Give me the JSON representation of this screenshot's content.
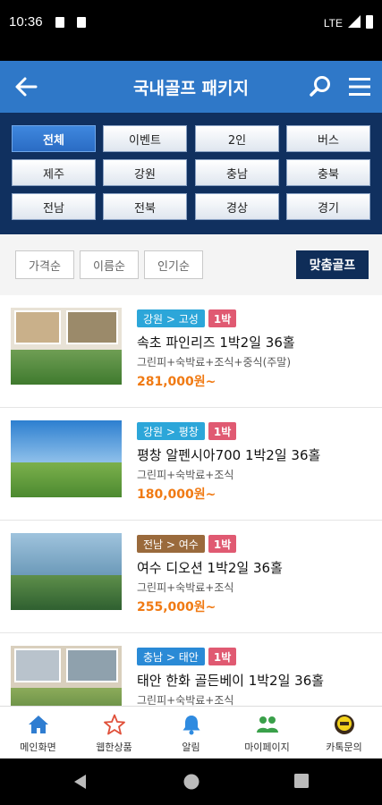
{
  "status_bar": {
    "time": "10:36",
    "network": "LTE"
  },
  "header": {
    "title": "국내골프 패키지",
    "back_icon": "back-arrow-icon",
    "search_icon": "search-icon",
    "menu_icon": "hamburger-menu-icon"
  },
  "filters": [
    {
      "label": "전체",
      "active": true
    },
    {
      "label": "이벤트",
      "active": false
    },
    {
      "label": "2인",
      "active": false
    },
    {
      "label": "버스",
      "active": false
    },
    {
      "label": "제주",
      "active": false
    },
    {
      "label": "강원",
      "active": false
    },
    {
      "label": "충남",
      "active": false
    },
    {
      "label": "충북",
      "active": false
    },
    {
      "label": "전남",
      "active": false
    },
    {
      "label": "전북",
      "active": false
    },
    {
      "label": "경상",
      "active": false
    },
    {
      "label": "경기",
      "active": false
    }
  ],
  "sort": {
    "options": [
      "가격순",
      "이름순",
      "인기순"
    ],
    "custom_label": "맞춤골프"
  },
  "products": [
    {
      "region": "강원 > 고성",
      "region_color": "#2ca6d9",
      "nights": "1박",
      "title": "속초 파인리즈 1박2일 36홀",
      "desc": "그린피+숙박료+조식+중식(주말)",
      "price": "281,000원~"
    },
    {
      "region": "강원 > 평창",
      "region_color": "#2ca6d9",
      "nights": "1박",
      "title": "평창 알펜시아700 1박2일 36홀",
      "desc": "그린피+숙박료+조식",
      "price": "180,000원~"
    },
    {
      "region": "전남 > 여수",
      "region_color": "#9a6a3c",
      "nights": "1박",
      "title": "여수 디오션 1박2일 36홀",
      "desc": "그린피+숙박료+조식",
      "price": "255,000원~"
    },
    {
      "region": "충남 > 태안",
      "region_color": "#2a8ad6",
      "nights": "1박",
      "title": "태안 한화 골든베이 1박2일 36홀",
      "desc": "그린피+숙박료+조식",
      "price": ""
    }
  ],
  "bottom_nav": [
    {
      "label": "메인화면",
      "icon": "home-icon"
    },
    {
      "label": "웹한상품",
      "icon": "star-icon"
    },
    {
      "label": "알림",
      "icon": "bell-icon"
    },
    {
      "label": "마이페이지",
      "icon": "people-icon"
    },
    {
      "label": "카톡문의",
      "icon": "kakaotalk-icon"
    }
  ],
  "colors": {
    "header": "#2f78c8",
    "filter_bg": "#10305f",
    "price": "#f07a13",
    "night_tag": "#e05a72"
  }
}
